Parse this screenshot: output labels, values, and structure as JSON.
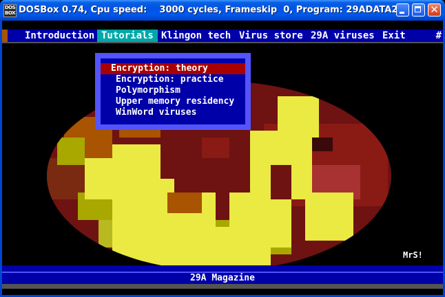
{
  "window": {
    "icon_text": "DOS BOX",
    "title": "DOSBox 0.74, Cpu speed:    3000 cycles, Frameskip  0, Program: 29ADATA2"
  },
  "menubar": {
    "items": [
      {
        "label": "Introduction"
      },
      {
        "label": "Tutorials"
      },
      {
        "label": "Klingon tech"
      },
      {
        "label": "Virus store"
      },
      {
        "label": "29A viruses"
      },
      {
        "label": "Exit"
      }
    ],
    "active_item": "Tutorials",
    "right_glyph": "#"
  },
  "dropdown": {
    "items": [
      {
        "label": "Encryption: theory"
      },
      {
        "label": "Encryption: practice"
      },
      {
        "label": "Polymorphism"
      },
      {
        "label": "Upper memory residency"
      },
      {
        "label": "WinWord viruses"
      }
    ],
    "selected_item": "Encryption: theory"
  },
  "signature": "MrS!",
  "statusbar": {
    "text": "29A Magazine"
  },
  "colors": {
    "dos_blue": "#0000a8",
    "menu_active": "#00a8a8",
    "selection_red": "#a80000",
    "popup_border": "#5454fc",
    "art_yellow": "#fcfc54",
    "art_dark_yellow": "#a8a800",
    "art_brown": "#a85400",
    "art_dark_red": "#7a0e0e"
  },
  "icons": [
    "dosbox-app-icon",
    "minimize-icon",
    "maximize-icon",
    "close-icon"
  ]
}
